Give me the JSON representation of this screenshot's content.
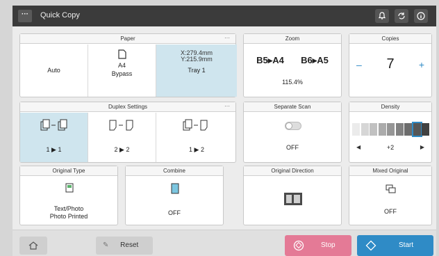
{
  "header": {
    "menu_glyph": "···",
    "title": "Quick Copy",
    "icons": [
      "bell-icon",
      "refresh-icon",
      "info-icon"
    ]
  },
  "paper": {
    "title": "Paper",
    "more": "···",
    "auto": "Auto",
    "bypass_size": "A4",
    "bypass_label": "Bypass",
    "custom_x": "X:279.4mm",
    "custom_y": "Y:215.9mm",
    "tray": "Tray 1"
  },
  "zoom": {
    "title": "Zoom",
    "option1": "B5▸A4",
    "option2": "B6▸A5",
    "value": "115.4%"
  },
  "copies": {
    "title": "Copies",
    "minus": "–",
    "value": "7",
    "plus": "+"
  },
  "duplex": {
    "title": "Duplex Settings",
    "more": "···",
    "options": [
      "1 ▶ 1",
      "2 ▶ 2",
      "1 ▶ 2"
    ]
  },
  "separate_scan": {
    "title": "Separate Scan",
    "value": "OFF"
  },
  "density": {
    "title": "Density",
    "value": "+2",
    "left": "◀",
    "right": "▶",
    "level_index": 7,
    "levels": 9
  },
  "original_type": {
    "title": "Original Type",
    "line1": "Text/Photo",
    "line2": "Photo Printed"
  },
  "combine": {
    "title": "Combine",
    "value": "OFF"
  },
  "original_direction": {
    "title": "Original Direction"
  },
  "mixed_original": {
    "title": "Mixed Original",
    "value": "OFF"
  },
  "footer": {
    "reset": "Reset",
    "stop": "Stop",
    "start": "Start"
  },
  "colors": {
    "selected": "#cfe5ee",
    "accent_blue": "#2f8bc6",
    "stop_pink": "#e47a96"
  }
}
